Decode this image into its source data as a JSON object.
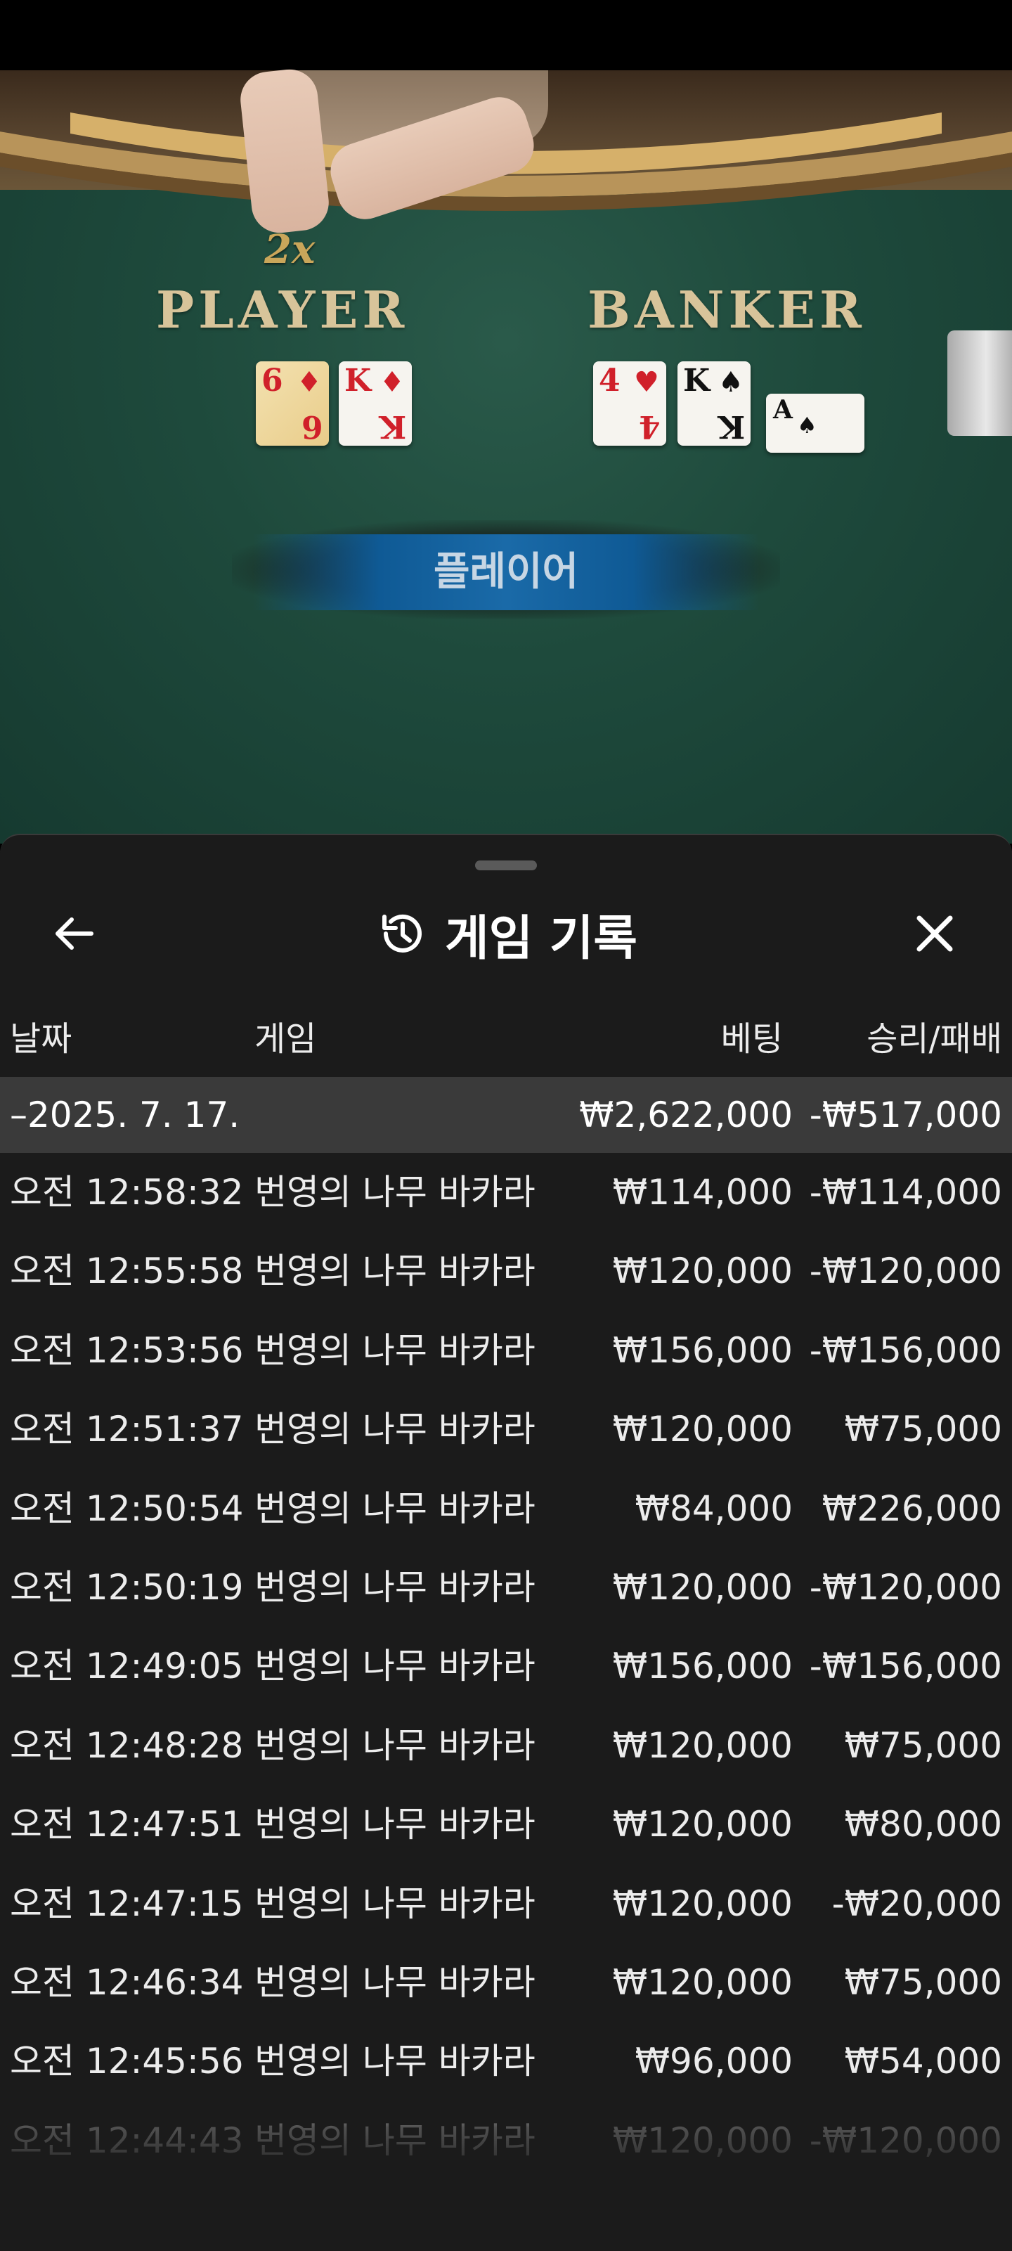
{
  "video": {
    "player_label": "PLAYER",
    "banker_label": "BANKER",
    "multiplier": "2x",
    "result_text": "플레이어",
    "player_cards": [
      {
        "rank": "6",
        "suit": "♦",
        "color": "red",
        "gold": true
      },
      {
        "rank": "K",
        "suit": "♦",
        "color": "red",
        "gold": false
      }
    ],
    "banker_cards": [
      {
        "rank": "4",
        "suit": "♥",
        "color": "red"
      },
      {
        "rank": "K",
        "suit": "♠",
        "color": "black"
      },
      {
        "rank": "A",
        "suit": "♠",
        "color": "black"
      }
    ]
  },
  "sheet": {
    "title": "게임 기록",
    "back_icon": "arrow-left-icon",
    "history_icon": "history-icon",
    "close_icon": "close-icon",
    "columns": {
      "date": "날짜",
      "game": "게임",
      "bet": "베팅",
      "result": "승리/패배"
    },
    "date_group": {
      "date": "–2025. 7. 17.",
      "total_bet": "₩2,622,000",
      "total_result": "-₩517,000"
    },
    "rows": [
      {
        "time": "오전 12:58:32",
        "game": "번영의 나무 바카라",
        "bet": "₩114,000",
        "result": "-₩114,000"
      },
      {
        "time": "오전 12:55:58",
        "game": "번영의 나무 바카라",
        "bet": "₩120,000",
        "result": "-₩120,000"
      },
      {
        "time": "오전 12:53:56",
        "game": "번영의 나무 바카라",
        "bet": "₩156,000",
        "result": "-₩156,000"
      },
      {
        "time": "오전 12:51:37",
        "game": "번영의 나무 바카라",
        "bet": "₩120,000",
        "result": "₩75,000"
      },
      {
        "time": "오전 12:50:54",
        "game": "번영의 나무 바카라",
        "bet": "₩84,000",
        "result": "₩226,000"
      },
      {
        "time": "오전 12:50:19",
        "game": "번영의 나무 바카라",
        "bet": "₩120,000",
        "result": "-₩120,000"
      },
      {
        "time": "오전 12:49:05",
        "game": "번영의 나무 바카라",
        "bet": "₩156,000",
        "result": "-₩156,000"
      },
      {
        "time": "오전 12:48:28",
        "game": "번영의 나무 바카라",
        "bet": "₩120,000",
        "result": "₩75,000"
      },
      {
        "time": "오전 12:47:51",
        "game": "번영의 나무 바카라",
        "bet": "₩120,000",
        "result": "₩80,000"
      },
      {
        "time": "오전 12:47:15",
        "game": "번영의 나무 바카라",
        "bet": "₩120,000",
        "result": "-₩20,000"
      },
      {
        "time": "오전 12:46:34",
        "game": "번영의 나무 바카라",
        "bet": "₩120,000",
        "result": "₩75,000"
      },
      {
        "time": "오전 12:45:56",
        "game": "번영의 나무 바카라",
        "bet": "₩96,000",
        "result": "₩54,000"
      },
      {
        "time": "오전 12:44:43",
        "game": "번영의 나무 바카라",
        "bet": "₩120,000",
        "result": "-₩120,000"
      }
    ]
  }
}
